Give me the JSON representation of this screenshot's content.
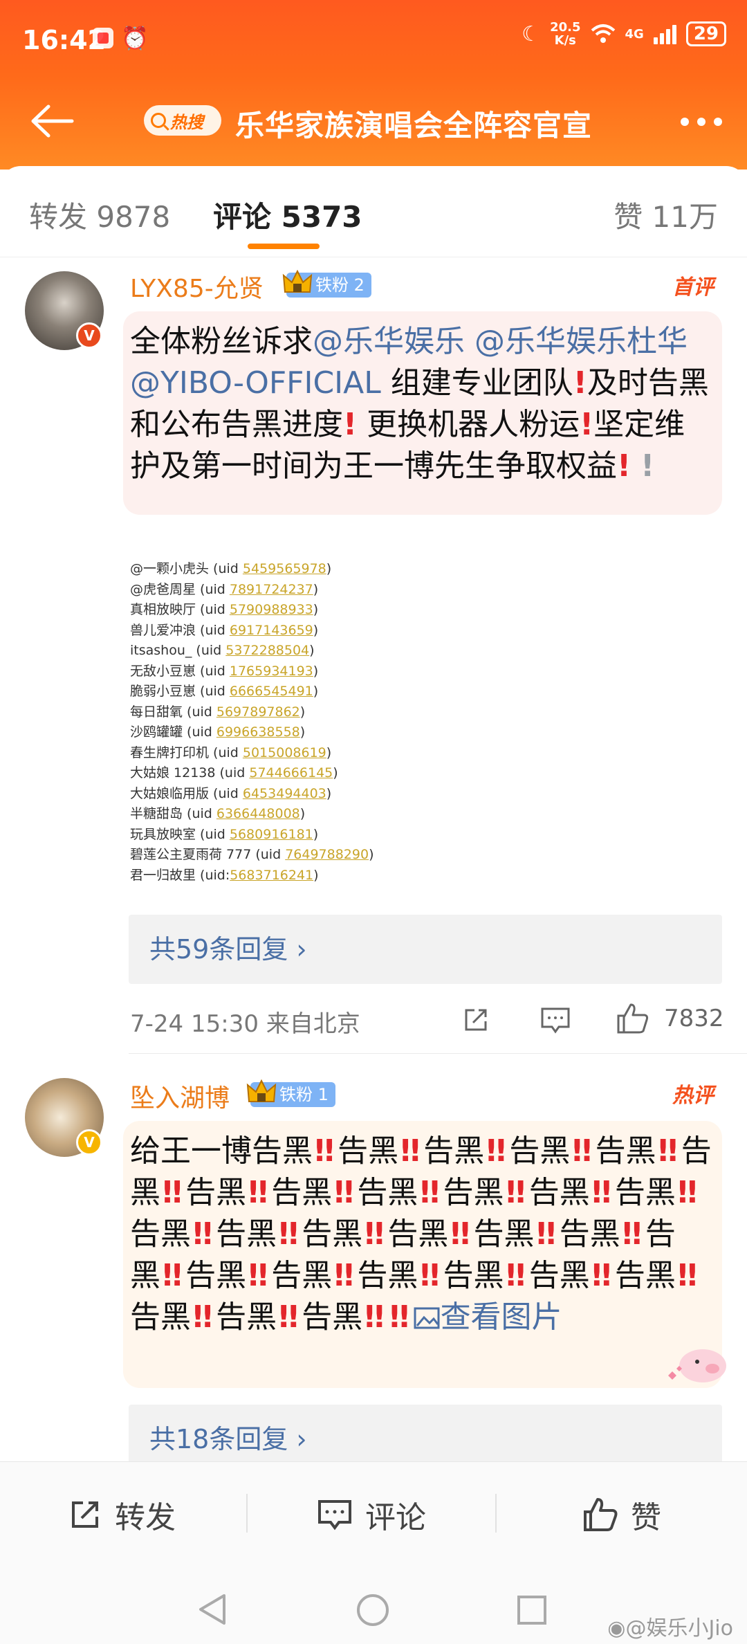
{
  "status_bar": {
    "time": "16:42",
    "speed_value": "20.5",
    "speed_unit": "K/s",
    "network": "4G",
    "battery": "29"
  },
  "topbar": {
    "hot_tag": "热搜",
    "title": "乐华家族演唱会全阵容官宣"
  },
  "tabs": {
    "repost": "转发 9878",
    "comments": "评论 5373",
    "likes": "赞 11万"
  },
  "comments": [
    {
      "username": "LYX85-允贤",
      "fan_badge": "铁粉 2",
      "ribbon": "首评",
      "text_parts": {
        "p1": "全体粉丝诉求",
        "m1": "@乐华娱乐",
        "m2": "@乐华娱乐杜华",
        "m3": "@YIBO-OFFICIAL",
        "p2": " 组建专业团队",
        "p3": "及时告黑和公布告黑进度",
        "p4": " 更换机器人粉运",
        "p5": "坚定维护及第一时间为王一博先生争取权益"
      },
      "uid_list": [
        {
          "name": "@一颗小虎头 (uid ",
          "uid": "5459565978",
          "end": ")"
        },
        {
          "name": "@虎爸周星 (uid ",
          "uid": "7891724237",
          "end": ")"
        },
        {
          "name": "真相放映厅 (uid ",
          "uid": "5790988933",
          "end": ")"
        },
        {
          "name": "兽儿爱冲浪 (uid ",
          "uid": "6917143659",
          "end": ")"
        },
        {
          "name": "itsashou_ (uid ",
          "uid": "5372288504",
          "end": ")"
        },
        {
          "name": "无敌小豆崽 (uid ",
          "uid": "1765934193",
          "end": ")"
        },
        {
          "name": "脆弱小豆崽 (uid ",
          "uid": "6666545491",
          "end": ")"
        },
        {
          "name": "每日甜氧 (uid ",
          "uid": "5697897862",
          "end": ")"
        },
        {
          "name": "沙鸥罐罐 (uid ",
          "uid": "6996638558",
          "end": ")"
        },
        {
          "name": "春生牌打印机 (uid ",
          "uid": "5015008619",
          "end": ")"
        },
        {
          "name": "大姑娘 12138 (uid ",
          "uid": "5744666145",
          "end": ")"
        },
        {
          "name": "大姑娘临用版 (uid ",
          "uid": "6453494403",
          "end": ")"
        },
        {
          "name": "半糖甜岛 (uid ",
          "uid": "6366448008",
          "end": ")"
        },
        {
          "name": "玩具放映室 (uid ",
          "uid": "5680916181",
          "end": ")"
        },
        {
          "name": "碧莲公主夏雨荷 777 (uid ",
          "uid": "7649788290",
          "end": ")"
        },
        {
          "name": "君一归故里 (uid:",
          "uid": "5683716241",
          "end": ")"
        }
      ],
      "replies": "共59条回复 ›",
      "meta": "7-24 15:30 来自北京",
      "like_count": "7832"
    },
    {
      "username": "坠入湖博",
      "fan_badge": "铁粉 1",
      "ribbon": "热评",
      "lead": "给王一博",
      "repeat_word": "告黑",
      "repeat_count": 28,
      "view_image": "查看图片",
      "replies": "共18条回复 ›"
    }
  ],
  "bottom_bar": {
    "repost": "转发",
    "comment": "评论",
    "like": "赞"
  },
  "watermark": "@娱乐小Jio",
  "colors": {
    "header_orange": "#ff6a1a",
    "username_orange": "#eb7c1a",
    "mention_blue": "#4a6fa5",
    "uid_gold": "#c9a52a",
    "alert_red": "#e3262b",
    "fan_badge_blue": "#7eb3f5"
  },
  "icons": [
    "back-arrow-icon",
    "search-icon",
    "more-icon",
    "crown-icon",
    "share-icon",
    "reply-icon",
    "like-icon",
    "image-icon",
    "back-nav-icon",
    "home-nav-icon",
    "recent-nav-icon",
    "weibo-icon"
  ]
}
